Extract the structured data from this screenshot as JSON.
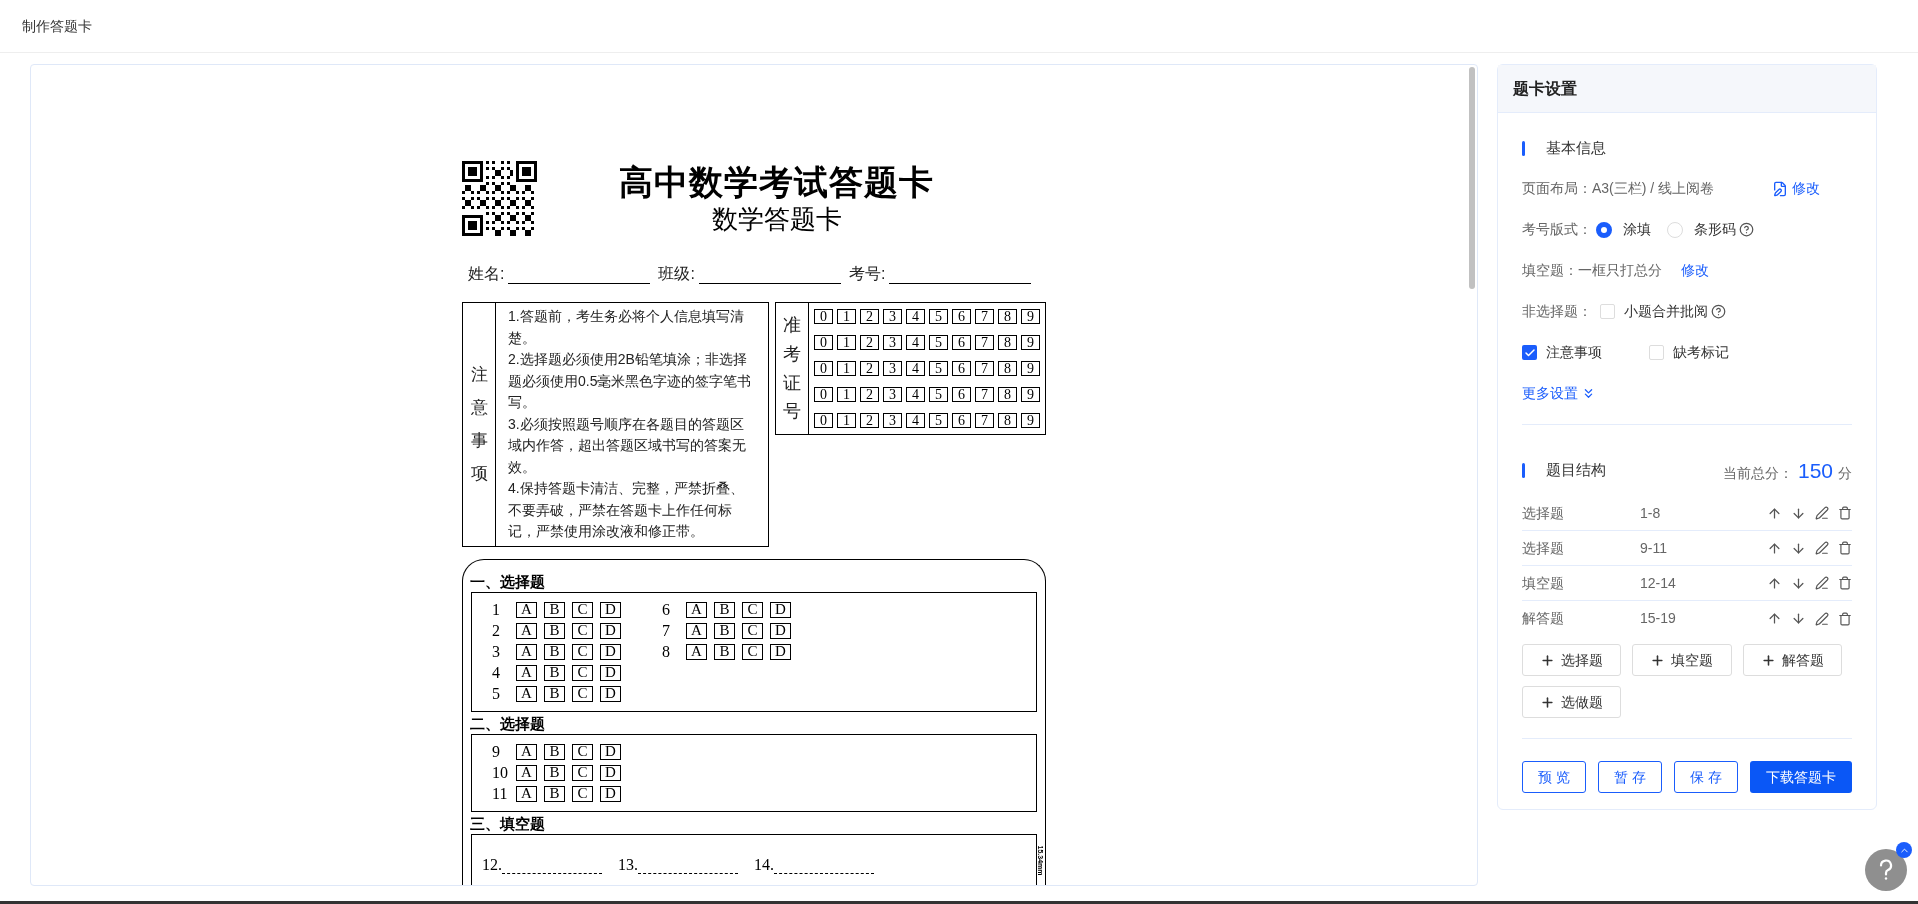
{
  "header": {
    "title": "制作答题卡"
  },
  "card": {
    "title": "高中数学考试答题卡",
    "subtitle": "数学答题卡",
    "info_fields": [
      {
        "label": "姓名:"
      },
      {
        "label": "班级:"
      },
      {
        "label": "考号:"
      }
    ],
    "notes": {
      "heading": "注意事项",
      "items": [
        "1.答题前，考生务必将个人信息填写清楚。",
        "2.选择题必须使用2B铅笔填涂；非选择题必须使用0.5毫米黑色字迹的签字笔书写。",
        "3.必须按照题号顺序在各题目的答题区域内作答，超出答题区域书写的答案无效。",
        "4.保持答题卡清洁、完整，严禁折叠、不要弄破，严禁在答题卡上作任何标记，严禁使用涂改液和修正带。"
      ]
    },
    "admission": {
      "heading": "准考证号",
      "rows": [
        [
          "0",
          "1",
          "2",
          "3",
          "4",
          "5",
          "6",
          "7",
          "8",
          "9"
        ],
        [
          "0",
          "1",
          "2",
          "3",
          "4",
          "5",
          "6",
          "7",
          "8",
          "9"
        ],
        [
          "0",
          "1",
          "2",
          "3",
          "4",
          "5",
          "6",
          "7",
          "8",
          "9"
        ],
        [
          "0",
          "1",
          "2",
          "3",
          "4",
          "5",
          "6",
          "7",
          "8",
          "9"
        ],
        [
          "0",
          "1",
          "2",
          "3",
          "4",
          "5",
          "6",
          "7",
          "8",
          "9"
        ]
      ]
    },
    "sections": [
      {
        "heading": "一、选择题",
        "kind": "choice",
        "columns": [
          [
            {
              "number": "1",
              "options": [
                "A",
                "B",
                "C",
                "D"
              ]
            },
            {
              "number": "2",
              "options": [
                "A",
                "B",
                "C",
                "D"
              ]
            },
            {
              "number": "3",
              "options": [
                "A",
                "B",
                "C",
                "D"
              ]
            },
            {
              "number": "4",
              "options": [
                "A",
                "B",
                "C",
                "D"
              ]
            },
            {
              "number": "5",
              "options": [
                "A",
                "B",
                "C",
                "D"
              ]
            }
          ],
          [
            {
              "number": "6",
              "options": [
                "A",
                "B",
                "C",
                "D"
              ]
            },
            {
              "number": "7",
              "options": [
                "A",
                "B",
                "C",
                "D"
              ]
            },
            {
              "number": "8",
              "options": [
                "A",
                "B",
                "C",
                "D"
              ]
            }
          ]
        ]
      },
      {
        "heading": "二、选择题",
        "kind": "choice",
        "columns": [
          [
            {
              "number": "9",
              "options": [
                "A",
                "B",
                "C",
                "D"
              ]
            },
            {
              "number": "10",
              "options": [
                "A",
                "B",
                "C",
                "D"
              ]
            },
            {
              "number": "11",
              "options": [
                "A",
                "B",
                "C",
                "D"
              ]
            }
          ]
        ]
      },
      {
        "heading": "三、填空题",
        "kind": "blank",
        "items": [
          {
            "number": "12."
          },
          {
            "number": "13."
          },
          {
            "number": "14."
          }
        ],
        "side_note": "15.34mm"
      }
    ]
  },
  "settings": {
    "title": "题卡设置",
    "basic": {
      "heading": "基本信息",
      "rows": [
        {
          "kind": "info",
          "label": "页面布局：",
          "value": "A3(三栏) / 线上阅卷",
          "link": "修改",
          "link_icon": true
        },
        {
          "kind": "radio",
          "label": "考号版式：",
          "options": [
            {
              "label": "涂填",
              "selected": true,
              "help": false
            },
            {
              "label": "条形码",
              "selected": false,
              "help": true
            }
          ]
        },
        {
          "kind": "info",
          "label": "填空题：",
          "value": "一框只打总分",
          "link": "修改",
          "link_icon": false
        },
        {
          "kind": "checkbox",
          "label": "非选择题：",
          "options": [
            {
              "label": "小题合并批阅",
              "checked": false,
              "help": true
            }
          ]
        },
        {
          "kind": "checkbox",
          "options": [
            {
              "label": "注意事项",
              "checked": true,
              "help": false
            },
            {
              "label": "缺考标记",
              "checked": false,
              "help": false
            }
          ]
        }
      ],
      "more": "更多设置"
    },
    "structure": {
      "heading": "题目结构",
      "total_label": "当前总分：",
      "total": "150",
      "unit": "分",
      "rows": [
        {
          "type": "选择题",
          "range": "1-8"
        },
        {
          "type": "选择题",
          "range": "9-11"
        },
        {
          "type": "填空题",
          "range": "12-14"
        },
        {
          "type": "解答题",
          "range": "15-19"
        }
      ],
      "add_buttons": [
        "选择题",
        "填空题",
        "解答题",
        "选做题"
      ]
    },
    "actions": [
      {
        "label": "预 览",
        "kind": "outline"
      },
      {
        "label": "暂 存",
        "kind": "outline"
      },
      {
        "label": "保 存",
        "kind": "outline"
      },
      {
        "label": "下载答题卡",
        "kind": "primary"
      }
    ]
  }
}
